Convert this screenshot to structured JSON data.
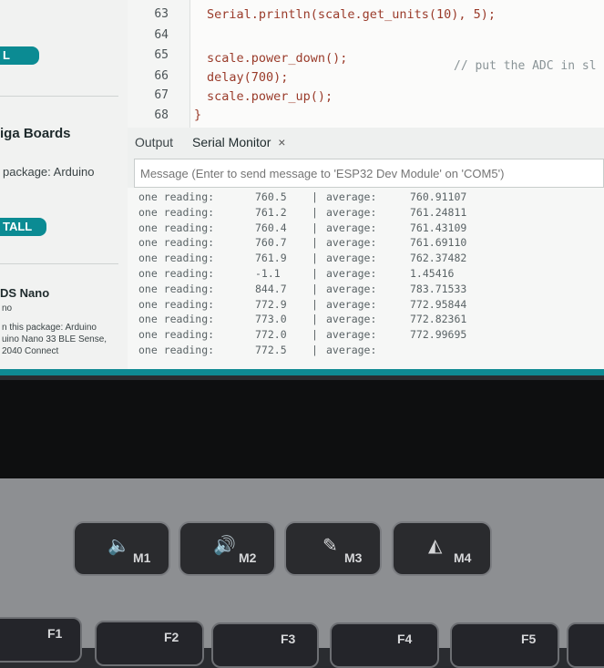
{
  "sidebar": {
    "button_top": "L",
    "boards_title": "iga Boards",
    "package_text": "package: Arduino",
    "install_button": "TALL",
    "nano_title": "DS Nano",
    "nano_sub": "no",
    "nano_desc_1": "n this package: Arduino",
    "nano_desc_2": "uino Nano 33 BLE Sense,",
    "nano_desc_3": "2040 Connect"
  },
  "editor": {
    "line_numbers": [
      "63",
      "64",
      "65",
      "66",
      "67",
      "68"
    ],
    "line63": "Serial.println(scale.get_units(10), 5);",
    "line65": "scale.power_down();",
    "line65_comment": "// put the ADC in sl",
    "line66": "delay(700);",
    "line67": "scale.power_up();",
    "line68": "}"
  },
  "panel": {
    "tab_output": "Output",
    "tab_serial": "Serial Monitor",
    "close_glyph": "×",
    "message_placeholder": "Message (Enter to send message to 'ESP32 Dev Module' on 'COM5')"
  },
  "serial_rows": [
    {
      "label": "one reading:",
      "value": "760.5",
      "sep": "|",
      "avg_label": "average:",
      "avg": "760.91107"
    },
    {
      "label": "one reading:",
      "value": "761.2",
      "sep": "|",
      "avg_label": "average:",
      "avg": "761.24811"
    },
    {
      "label": "one reading:",
      "value": "760.4",
      "sep": "|",
      "avg_label": "average:",
      "avg": "761.43109"
    },
    {
      "label": "one reading:",
      "value": "760.7",
      "sep": "|",
      "avg_label": "average:",
      "avg": "761.69110"
    },
    {
      "label": "one reading:",
      "value": "761.9",
      "sep": "|",
      "avg_label": "average:",
      "avg": "762.37482"
    },
    {
      "label": "one reading:",
      "value": "-1.1",
      "sep": "|",
      "avg_label": "average:",
      "avg": "1.45416"
    },
    {
      "label": "one reading:",
      "value": "844.7",
      "sep": "|",
      "avg_label": "average:",
      "avg": "783.71533"
    },
    {
      "label": "one reading:",
      "value": "772.9",
      "sep": "|",
      "avg_label": "average:",
      "avg": "772.95844"
    },
    {
      "label": "one reading:",
      "value": "773.0",
      "sep": "|",
      "avg_label": "average:",
      "avg": "772.82361"
    },
    {
      "label": "one reading:",
      "value": "772.0",
      "sep": "|",
      "avg_label": "average:",
      "avg": "772.99695"
    },
    {
      "label": "one reading:",
      "value": "772.5",
      "sep": "|",
      "avg_label": "average:",
      "avg": ""
    }
  ],
  "keyboard": {
    "macro_keys": [
      {
        "label": "M1",
        "icon": "speaker-low-icon"
      },
      {
        "label": "M2",
        "icon": "speaker-high-icon"
      },
      {
        "label": "M3",
        "icon": "mic-mute-icon"
      },
      {
        "label": "M4",
        "icon": "rog-logo-icon"
      }
    ],
    "fn_keys": [
      "F1",
      "F2",
      "F3",
      "F4",
      "F5"
    ]
  },
  "colors": {
    "accent": "#0f8a93",
    "code_string": "#9a3b2a",
    "code_function": "#b3540b"
  }
}
